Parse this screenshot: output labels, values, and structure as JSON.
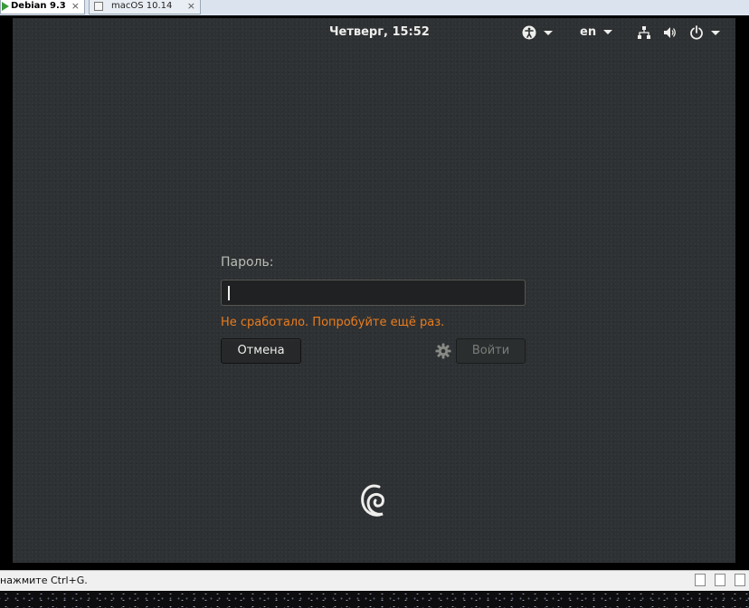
{
  "host": {
    "tabs": [
      {
        "label": "Debian 9.3",
        "close": "×"
      },
      {
        "label": "macOS 10.14",
        "close": "×"
      }
    ],
    "status_text": "нажмите Ctrl+G."
  },
  "topbar": {
    "clock": "Четверг, 15:52",
    "language": "en",
    "icons": [
      "accessibility-icon",
      "network-icon",
      "volume-icon",
      "power-icon"
    ]
  },
  "login": {
    "password_label": "Пароль:",
    "password_value": "",
    "error_message": "Не сработало. Попробуйте ещё раз.",
    "cancel_label": "Отмена",
    "login_label": "Войти"
  },
  "colors": {
    "background": "#2e3133",
    "error": "#e97c1e",
    "text": "#eeeeec"
  }
}
